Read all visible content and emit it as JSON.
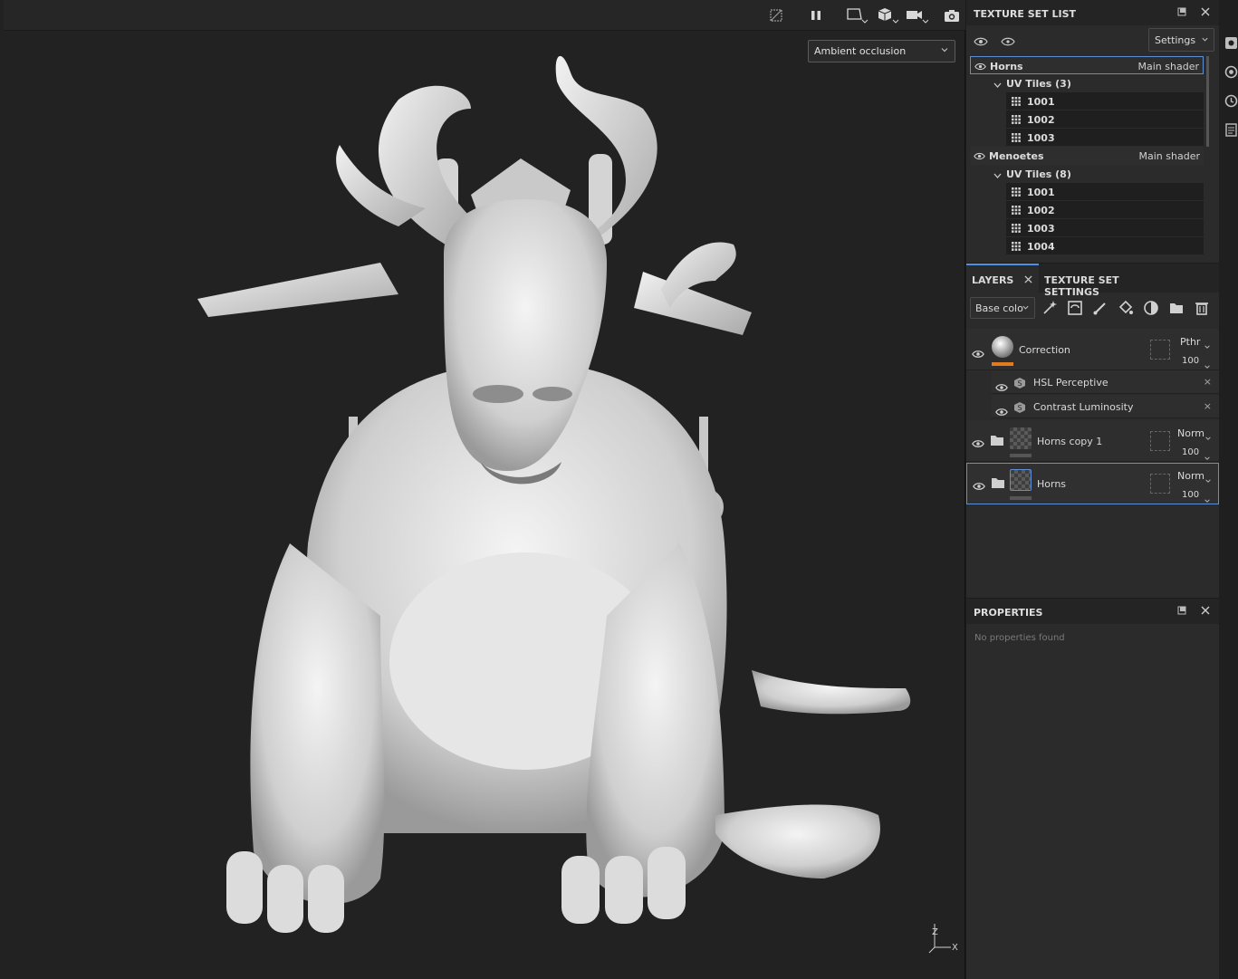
{
  "viewport": {
    "shading_mode": "Ambient occlusion",
    "toolbar_icons": [
      "hide-icon",
      "pause-icon",
      "frame-icon",
      "cube-icon",
      "camera-video-icon",
      "screenshot-icon"
    ],
    "axis_labels": {
      "z": "Z",
      "x": "X"
    }
  },
  "texture_set_list": {
    "title": "TEXTURE SET LIST",
    "settings_label": "Settings",
    "sets": [
      {
        "name": "Horns",
        "shader": "Main shader",
        "selected": true,
        "uv_label": "UV Tiles (3)",
        "tiles": [
          "1001",
          "1002",
          "1003"
        ]
      },
      {
        "name": "Menoetes",
        "shader": "Main shader",
        "selected": false,
        "uv_label": "UV Tiles (8)",
        "tiles": [
          "1001",
          "1002",
          "1003",
          "1004"
        ]
      }
    ]
  },
  "layers_panel": {
    "tabs": [
      {
        "label": "LAYERS",
        "active": true
      },
      {
        "label": "TEXTURE SET SETTINGS",
        "active": false
      }
    ],
    "channel": "Base colo",
    "layers": [
      {
        "name": "Correction",
        "blend": "Pthr",
        "opacity": "100",
        "swatch_color": "#e07b1f",
        "effects": [
          {
            "name": "HSL Perceptive"
          },
          {
            "name": "Contrast Luminosity"
          }
        ]
      },
      {
        "name": "Horns copy 1",
        "blend": "Norm",
        "opacity": "100"
      },
      {
        "name": "Horns",
        "blend": "Norm",
        "opacity": "100",
        "selected": true
      }
    ]
  },
  "properties": {
    "title": "PROPERTIES",
    "empty_text": "No properties found"
  },
  "colors": {
    "accent": "#5d8fd6",
    "swatch_orange": "#e07b1f"
  }
}
